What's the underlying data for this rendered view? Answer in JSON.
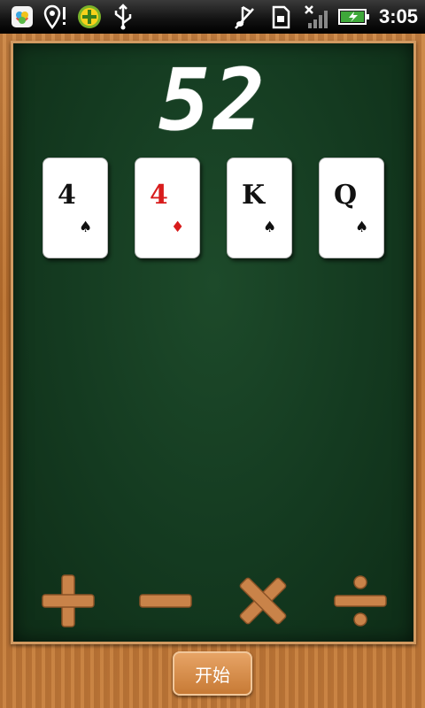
{
  "status_bar": {
    "time": "3:05",
    "left_icons": [
      "app-store-icon",
      "location-alert-icon",
      "plus-badge-icon",
      "usb-icon"
    ],
    "right_icons": [
      "music-off-icon",
      "sd-card-icon",
      "signal-no-service-icon",
      "battery-charging-icon"
    ]
  },
  "game": {
    "target_number": "52",
    "cards": [
      {
        "rank": "4",
        "suit": "♠",
        "color": "black"
      },
      {
        "rank": "4",
        "suit": "♦",
        "color": "red"
      },
      {
        "rank": "K",
        "suit": "♠",
        "color": "black"
      },
      {
        "rank": "Q",
        "suit": "♠",
        "color": "black"
      }
    ],
    "operators": [
      "plus",
      "minus",
      "multiply",
      "divide"
    ]
  },
  "start_button": {
    "label": "开始"
  },
  "colors": {
    "board_green": "#143a20",
    "wood": "#c47d3c",
    "card_red": "#d81c1c"
  }
}
